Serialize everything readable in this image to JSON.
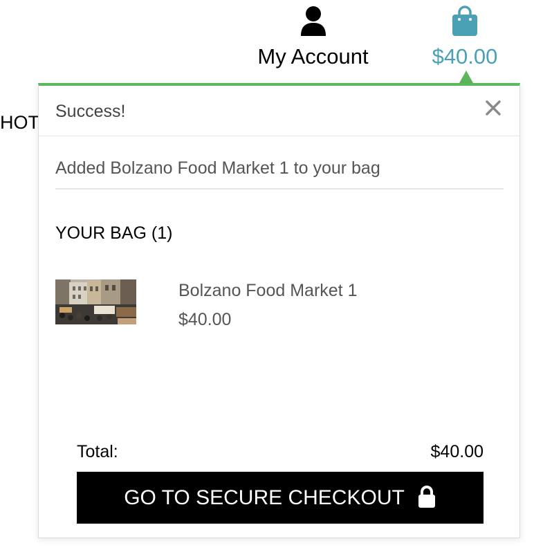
{
  "header": {
    "account_label": "My Account",
    "account_icon": "user-icon",
    "bag_total": "$40.00",
    "bag_icon": "shopping-bag-icon",
    "accent_color": "#4aa0b5"
  },
  "background": {
    "partial_text": "HOT"
  },
  "toast": {
    "title": "Success!",
    "close_icon": "close-icon",
    "message": "Added Bolzano Food Market 1 to your bag",
    "accent_color": "#5cb85c",
    "bag_heading": "YOUR BAG (1)",
    "items": [
      {
        "name": "Bolzano Food Market 1",
        "price": "$40.00"
      }
    ],
    "total_label": "Total:",
    "total_value": "$40.00",
    "checkout_label": "GO TO SECURE CHECKOUT",
    "checkout_icon": "lock-icon"
  }
}
